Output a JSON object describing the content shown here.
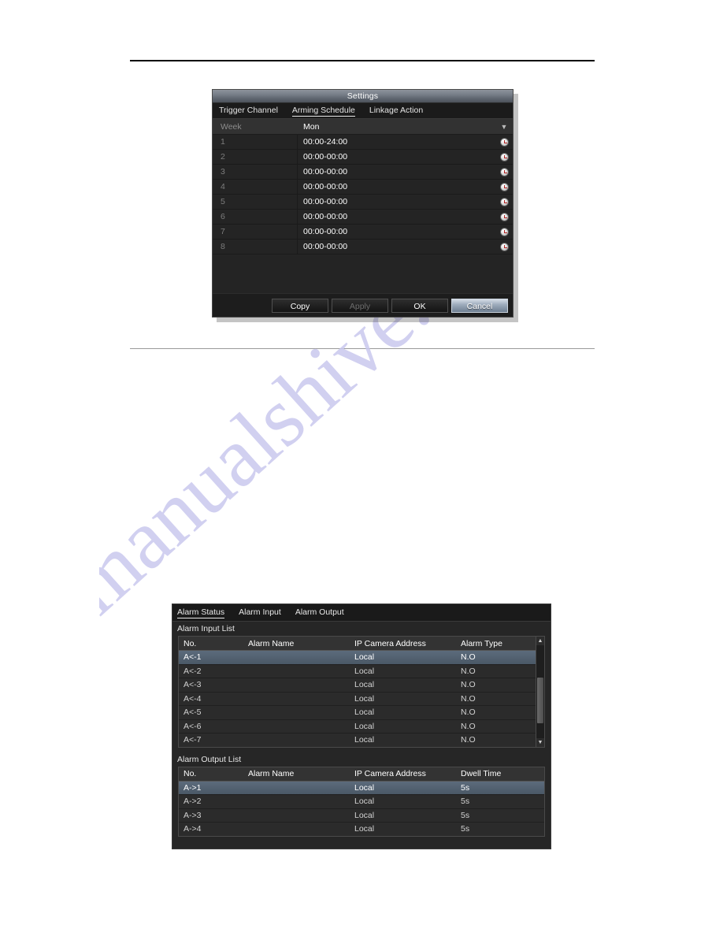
{
  "page": {
    "watermark_text": "manualshive.com",
    "watermark_color": "#c9c8ee"
  },
  "settings_dialog": {
    "title": "Settings",
    "tabs": [
      {
        "label": "Trigger Channel",
        "active": false
      },
      {
        "label": "Arming Schedule",
        "active": true
      },
      {
        "label": "Linkage Action",
        "active": false
      }
    ],
    "week_label": "Week",
    "week_value": "Mon",
    "week_caret_icon": "chevron-down-icon",
    "row_icon": "clock-icon",
    "schedule_rows": [
      {
        "no": "1",
        "time": "00:00-24:00"
      },
      {
        "no": "2",
        "time": "00:00-00:00"
      },
      {
        "no": "3",
        "time": "00:00-00:00"
      },
      {
        "no": "4",
        "time": "00:00-00:00"
      },
      {
        "no": "5",
        "time": "00:00-00:00"
      },
      {
        "no": "6",
        "time": "00:00-00:00"
      },
      {
        "no": "7",
        "time": "00:00-00:00"
      },
      {
        "no": "8",
        "time": "00:00-00:00"
      }
    ],
    "buttons": [
      {
        "label": "Copy",
        "state": "normal"
      },
      {
        "label": "Apply",
        "state": "disabled"
      },
      {
        "label": "OK",
        "state": "normal"
      },
      {
        "label": "Cancel",
        "state": "primary"
      }
    ]
  },
  "alarm_panel": {
    "tabs": [
      {
        "label": "Alarm Status",
        "active": true
      },
      {
        "label": "Alarm Input",
        "active": false
      },
      {
        "label": "Alarm Output",
        "active": false
      }
    ],
    "input_list": {
      "caption": "Alarm Input List",
      "columns": [
        "No.",
        "Alarm Name",
        "IP Camera Address",
        "Alarm Type"
      ],
      "rows": [
        {
          "no": "A<-1",
          "name": "",
          "address": "Local",
          "type": "N.O",
          "selected": true
        },
        {
          "no": "A<-2",
          "name": "",
          "address": "Local",
          "type": "N.O",
          "selected": false
        },
        {
          "no": "A<-3",
          "name": "",
          "address": "Local",
          "type": "N.O",
          "selected": false
        },
        {
          "no": "A<-4",
          "name": "",
          "address": "Local",
          "type": "N.O",
          "selected": false
        },
        {
          "no": "A<-5",
          "name": "",
          "address": "Local",
          "type": "N.O",
          "selected": false
        },
        {
          "no": "A<-6",
          "name": "",
          "address": "Local",
          "type": "N.O",
          "selected": false
        },
        {
          "no": "A<-7",
          "name": "",
          "address": "Local",
          "type": "N.O",
          "selected": false
        }
      ],
      "scroll_up_icon": "caret-up-icon",
      "scroll_down_icon": "caret-down-icon"
    },
    "output_list": {
      "caption": "Alarm Output List",
      "columns": [
        "No.",
        "Alarm Name",
        "IP Camera Address",
        "Dwell Time"
      ],
      "rows": [
        {
          "no": "A->1",
          "name": "",
          "address": "Local",
          "dwell": "5s",
          "selected": true
        },
        {
          "no": "A->2",
          "name": "",
          "address": "Local",
          "dwell": "5s",
          "selected": false
        },
        {
          "no": "A->3",
          "name": "",
          "address": "Local",
          "dwell": "5s",
          "selected": false
        },
        {
          "no": "A->4",
          "name": "",
          "address": "Local",
          "dwell": "5s",
          "selected": false
        }
      ]
    }
  }
}
